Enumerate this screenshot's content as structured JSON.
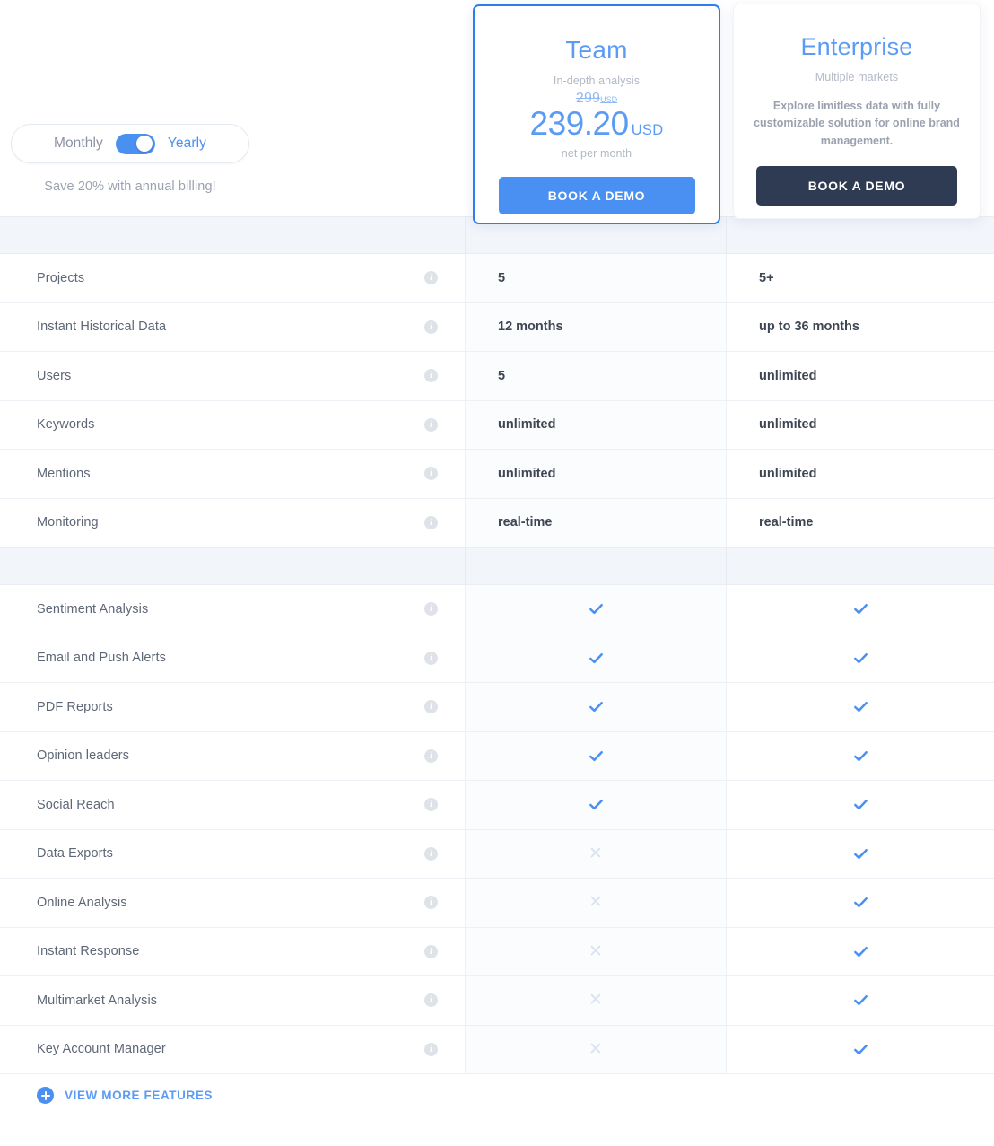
{
  "billing": {
    "monthly_label": "Monthly",
    "yearly_label": "Yearly",
    "selected": "Yearly",
    "save_note": "Save 20% with annual billing!",
    "accent_color": "#4a90f0"
  },
  "plans": [
    {
      "id": "team",
      "name": "Team",
      "subtitle": "In-depth analysis",
      "old_price": "299",
      "old_price_currency": "USD",
      "price": "239.20",
      "currency": "USD",
      "price_note": "net per month",
      "cta_label": "BOOK A DEMO",
      "highlighted": true,
      "accent_color": "#2f7ced"
    },
    {
      "id": "enterprise",
      "name": "Enterprise",
      "subtitle": "Multiple markets",
      "description": "Explore limitless data with fully customizable solution for online brand management.",
      "cta_label": "BOOK A DEMO",
      "highlighted": false,
      "accent_color": "#2e3b52"
    }
  ],
  "table": {
    "info_icon": "info-icon",
    "check_icon": "check-icon",
    "cross_icon": "cross-icon",
    "check_color": "#4a90f2",
    "cross_color": "#d9e2ee",
    "groups": [
      {
        "id": "limits",
        "rows": [
          {
            "label": "Projects",
            "team": "5",
            "enterprise": "5+"
          },
          {
            "label": "Instant Historical Data",
            "team": "12 months",
            "enterprise": "up to 36 months"
          },
          {
            "label": "Users",
            "team": "5",
            "enterprise": "unlimited"
          },
          {
            "label": "Keywords",
            "team": "unlimited",
            "enterprise": "unlimited"
          },
          {
            "label": "Mentions",
            "team": "unlimited",
            "enterprise": "unlimited"
          },
          {
            "label": "Monitoring",
            "team": "real-time",
            "enterprise": "real-time"
          }
        ]
      },
      {
        "id": "features",
        "rows": [
          {
            "label": "Sentiment Analysis",
            "team": "check",
            "enterprise": "check"
          },
          {
            "label": "Email and Push Alerts",
            "team": "check",
            "enterprise": "check"
          },
          {
            "label": "PDF Reports",
            "team": "check",
            "enterprise": "check"
          },
          {
            "label": "Opinion leaders",
            "team": "check",
            "enterprise": "check"
          },
          {
            "label": "Social Reach",
            "team": "check",
            "enterprise": "check"
          },
          {
            "label": "Data Exports",
            "team": "cross",
            "enterprise": "check"
          },
          {
            "label": "Online Analysis",
            "team": "cross",
            "enterprise": "check"
          },
          {
            "label": "Instant Response",
            "team": "cross",
            "enterprise": "check"
          },
          {
            "label": "Multimarket Analysis",
            "team": "cross",
            "enterprise": "check"
          },
          {
            "label": "Key Account Manager",
            "team": "cross",
            "enterprise": "check"
          }
        ]
      }
    ]
  },
  "footer": {
    "view_more_label": "VIEW MORE FEATURES",
    "plus_icon": "plus-circle-icon"
  }
}
